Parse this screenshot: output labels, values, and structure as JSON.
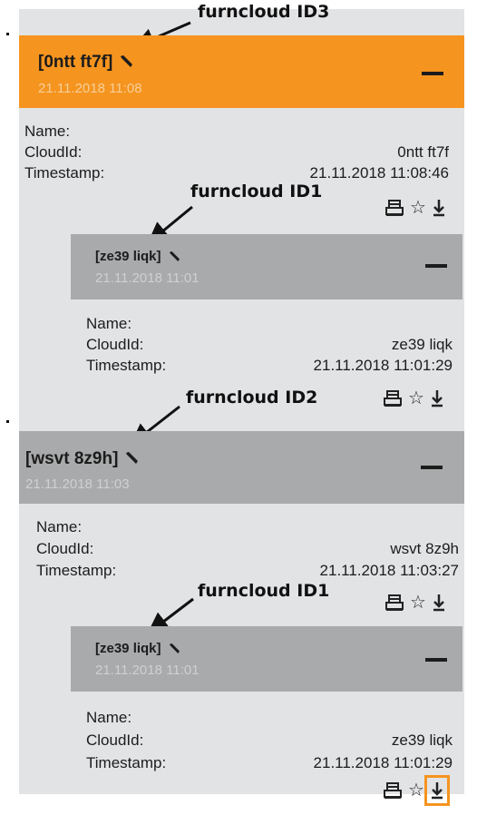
{
  "annotations": {
    "furncloud_id3": "furncloud ID3",
    "furncloud_id1_a": "furncloud ID1",
    "furncloud_id2": "furncloud ID2",
    "furncloud_id1_b": "furncloud ID1"
  },
  "fields": {
    "name_label": "Name:",
    "cloudid_label": "CloudId:",
    "timestamp_label": "Timestamp:"
  },
  "entries": [
    {
      "title": "[0ntt ft7f]",
      "header_time": "21.11.2018 11:08",
      "cloud_id": "0ntt ft7f",
      "timestamp": "21.11.2018 11:08:46",
      "sub": {
        "title": "[ze39 liqk]",
        "header_time": "21.11.2018 11:01",
        "cloud_id": "ze39 liqk",
        "timestamp": "21.11.2018 11:01:29"
      }
    },
    {
      "title": "[wsvt 8z9h]",
      "header_time": "21.11.2018 11:03",
      "cloud_id": "wsvt 8z9h",
      "timestamp": "21.11.2018 11:03:27",
      "sub": {
        "title": "[ze39 liqk]",
        "header_time": "21.11.2018 11:01",
        "cloud_id": "ze39 liqk",
        "timestamp": "21.11.2018 11:01:29"
      }
    }
  ],
  "icons": [
    "print-icon",
    "star-icon",
    "download-icon",
    "pencil-icon",
    "collapse-minus-icon",
    "annotation-arrow"
  ],
  "colors": {
    "active_header": "#f5941f",
    "inactive_header": "#a9aaab",
    "panel": "#e2e3e5",
    "highlight": "#f5941f"
  }
}
